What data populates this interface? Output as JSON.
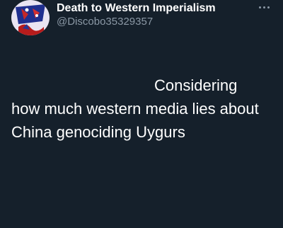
{
  "author": {
    "display_name": "Death to Western Imperialism",
    "handle": "@Discobo35329357",
    "avatar": "profile-avatar-icon"
  },
  "menu": {
    "icon": "more-horizontal-icon"
  },
  "tweet": {
    "lines": [
      "Considering",
      "how much western media lies about",
      "China genociding Uygurs"
    ]
  },
  "colors": {
    "background": "#15202b",
    "text_primary": "#ffffff",
    "text_secondary": "#8b98a5"
  }
}
